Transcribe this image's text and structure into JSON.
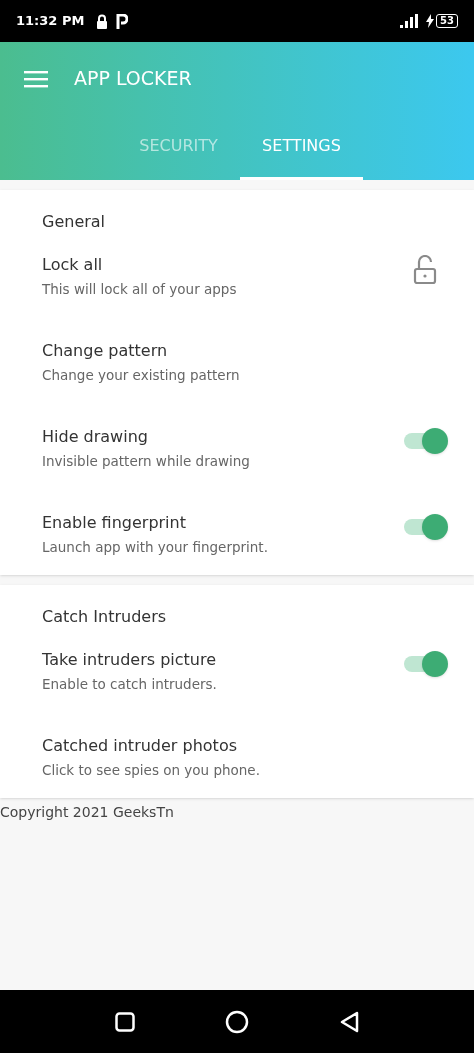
{
  "status_bar": {
    "time": "11:32 PM",
    "battery": "53"
  },
  "app_bar": {
    "title": "APP LOCKER"
  },
  "tabs": [
    {
      "label": "SECURITY",
      "selected": false
    },
    {
      "label": "SETTINGS",
      "selected": true
    }
  ],
  "sections": [
    {
      "header": "General",
      "items": [
        {
          "kind": "lock",
          "title": "Lock all",
          "subtitle": "This will lock all of your apps",
          "locked": false
        },
        {
          "kind": "plain",
          "title": "Change pattern",
          "subtitle": "Change your existing pattern"
        },
        {
          "kind": "switch",
          "title": "Hide drawing",
          "subtitle": "Invisible pattern while drawing",
          "on": true
        },
        {
          "kind": "switch",
          "title": "Enable fingerprint",
          "subtitle": "Launch app with your fingerprint.",
          "on": true
        }
      ]
    },
    {
      "header": "Catch Intruders",
      "items": [
        {
          "kind": "switch",
          "title": "Take intruders picture",
          "subtitle": "Enable to catch intruders.",
          "on": true
        },
        {
          "kind": "plain",
          "title": "Catched intruder photos",
          "subtitle": "Click to see spies on you phone."
        }
      ]
    }
  ],
  "footer": "Copyright 2021 GeeksTn"
}
